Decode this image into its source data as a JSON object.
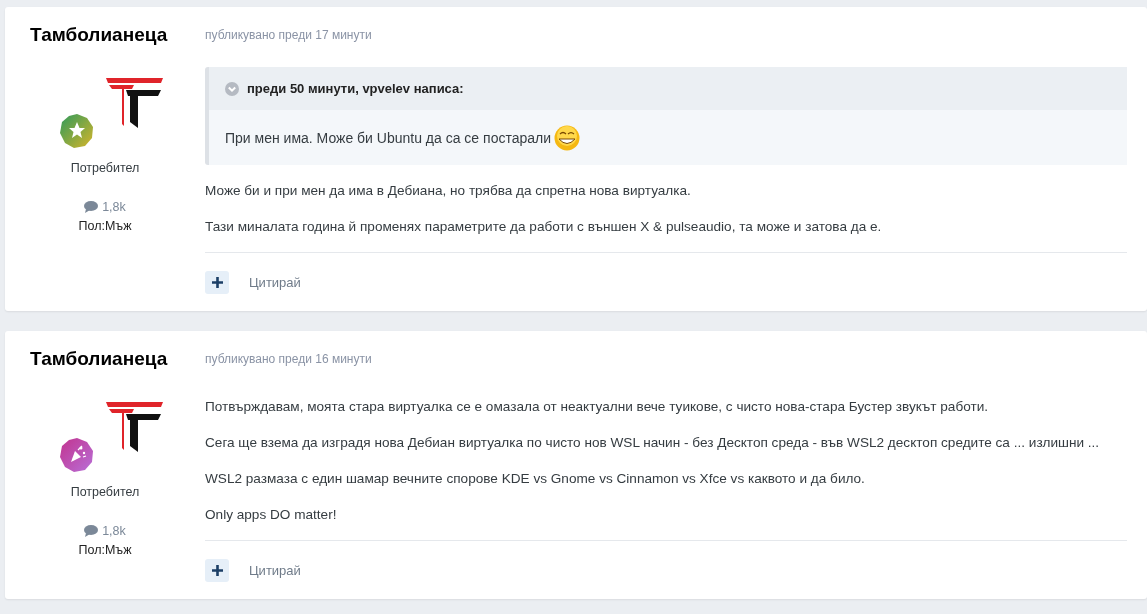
{
  "posts": [
    {
      "author": "Тамболианеца",
      "published": "публикувано преди 17 минути",
      "badge": {
        "kind": "star"
      },
      "role": "Потребител",
      "post_count": "1,8k",
      "gender": "Пол:Мъж",
      "quote": {
        "citation": "преди 50 минути, vpvelev написа:",
        "text": "При мен има. Може би Ubuntu да са се постарали",
        "smiley": true
      },
      "paragraphs": [
        "Може би и при мен да има в Дебиана, но трябва да спретна нова виртуалка.",
        "Тази миналата година й променях параметрите да работи с външен X & pulseaudio, та може и затова да е."
      ],
      "action": "Цитирай"
    },
    {
      "author": "Тамболианеца",
      "published": "публикувано преди 16 минути",
      "badge": {
        "kind": "confetti"
      },
      "role": "Потребител",
      "post_count": "1,8k",
      "gender": "Пол:Мъж",
      "paragraphs": [
        "Потвърждавам, моята стара виртуалка се е омазала от неактуални вече  туикове, с чисто нова-стара Бустер звукът работи.",
        "Сега ще взема да изградя нова Дебиан виртуалка по чисто нов WSL начин - без Десктоп среда - във WSL2 десктоп средите са ... излишни ...",
        "WSL2 размаза с един шамар вечните спорове KDE vs Gnome vs Cinnamon vs Xfce vs каквото и да било.",
        "Only apps DO matter!"
      ],
      "action": "Цитирай"
    }
  ]
}
